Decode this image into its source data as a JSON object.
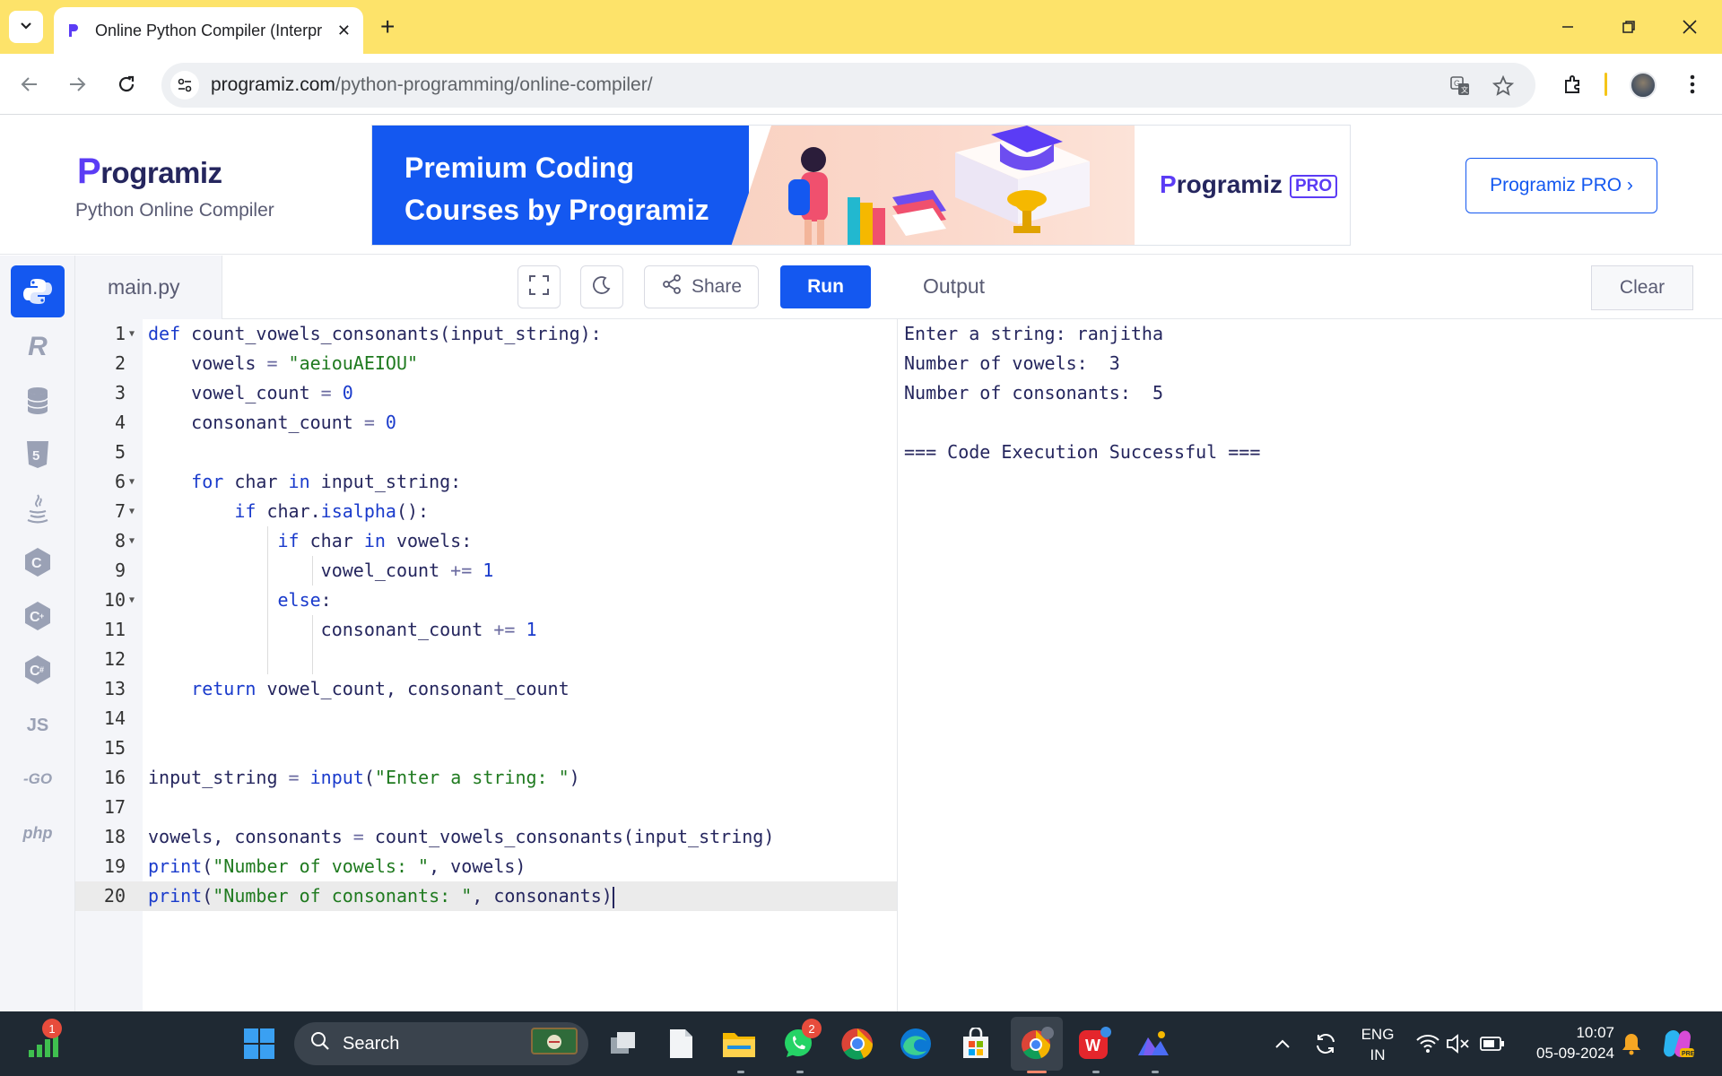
{
  "browser": {
    "tab_title": "Online Python Compiler (Interpr",
    "url_host": "programiz.com",
    "url_path": "/python-programming/online-compiler/"
  },
  "site": {
    "logo_p": "P",
    "logo_rest": "rogramiz",
    "subtitle": "Python Online Compiler",
    "banner_text": "Premium Coding\nCourses by Programiz",
    "banner_logo_p": "P",
    "banner_logo_rest": "rogramiz",
    "banner_pro": "PRO",
    "pro_button": "Programiz PRO ›"
  },
  "languages": [
    {
      "name": "python",
      "label": ""
    },
    {
      "name": "r",
      "label": "R"
    },
    {
      "name": "sql",
      "label": ""
    },
    {
      "name": "html",
      "label": "5"
    },
    {
      "name": "java",
      "label": ""
    },
    {
      "name": "c",
      "label": "C"
    },
    {
      "name": "cpp",
      "label": "C"
    },
    {
      "name": "csharp",
      "label": "C"
    },
    {
      "name": "js",
      "label": "JS"
    },
    {
      "name": "go",
      "label": "-GO"
    },
    {
      "name": "php",
      "label": "php"
    }
  ],
  "editor": {
    "file_name": "main.py",
    "share_label": "Share",
    "run_label": "Run",
    "lines": [
      "1",
      "2",
      "3",
      "4",
      "5",
      "6",
      "7",
      "8",
      "9",
      "10",
      "11",
      "12",
      "13",
      "14",
      "15",
      "16",
      "17",
      "18",
      "19",
      "20"
    ]
  },
  "output": {
    "title": "Output",
    "clear_label": "Clear",
    "lines": [
      "Enter a string: ranjitha",
      "Number of vowels:  3",
      "Number of consonants:  5",
      "",
      "=== Code Execution Successful ==="
    ]
  },
  "taskbar": {
    "search_placeholder": "Search",
    "widget_badge": "1",
    "whatsapp_badge": "2",
    "lang_line1": "ENG",
    "lang_line2": "IN",
    "time": "10:07",
    "date": "05-09-2024"
  },
  "colors": {
    "accent": "#1458f0",
    "tabbar": "#fde36a",
    "brand_purple": "#5b3cf5"
  }
}
